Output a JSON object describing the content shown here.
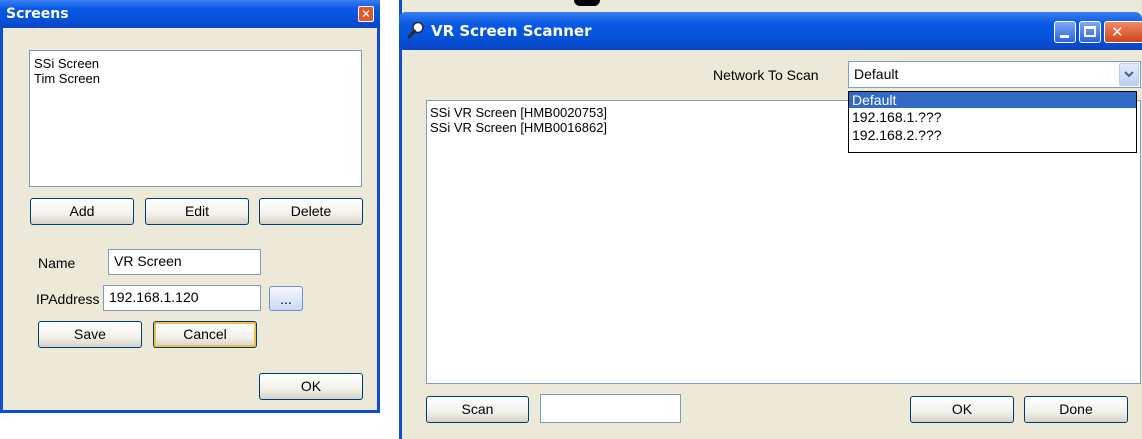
{
  "screens_window": {
    "title": "Screens",
    "list_items": [
      "SSi Screen",
      "Tim Screen"
    ],
    "add_label": "Add",
    "edit_label": "Edit",
    "delete_label": "Delete",
    "name_label": "Name",
    "name_value": "VR Screen",
    "ip_label": "IPAddress",
    "ip_value": "192.168.1.120",
    "browse_label": "...",
    "save_label": "Save",
    "cancel_label": "Cancel",
    "ok_label": "OK"
  },
  "scanner_window": {
    "title": "VR Screen Scanner",
    "network_label": "Network To Scan",
    "network_selected": "Default",
    "dropdown_options": [
      "Default",
      "192.168.1.???",
      "192.168.2.???"
    ],
    "results": [
      "SSi VR Screen [HMB0020753]",
      "SSi VR Screen [HMB0016862]"
    ],
    "scan_label": "Scan",
    "ok_label": "OK",
    "done_label": "Done"
  },
  "colors": {
    "title_blue": "#0a5ae6",
    "window_face": "#ece9d8",
    "selection": "#316ac5",
    "close_red": "#e2562b"
  }
}
